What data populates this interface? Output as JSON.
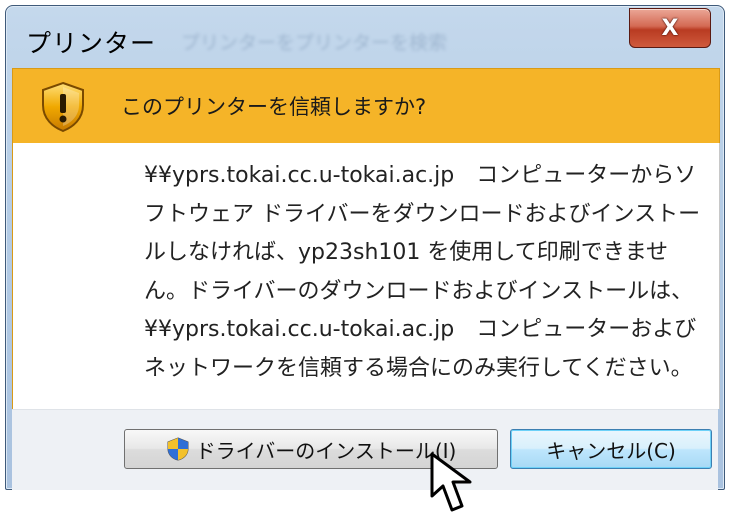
{
  "window": {
    "title": "プリンター",
    "title_ghost": "プリンターをプリンターを検索"
  },
  "title_buttons": {
    "close_label": "X",
    "close_icon": "close-icon"
  },
  "banner": {
    "icon": "shield-warning-icon",
    "message": "このプリンターを信頼しますか?",
    "color": "#f5b428"
  },
  "body": {
    "lines": [
      "¥¥yprs.tokai.cc.u-tokai.ac.jp　コンピューターからソ",
      "フトウェア ドライバーをダウンロードおよびインストー",
      "ルしなければ、yp23sh101 を使用して印刷できませ",
      "ん。ドライバーのダウンロードおよびインストールは、",
      "¥¥yprs.tokai.cc.u-tokai.ac.jp　コンピューターおよび",
      "ネットワークを信頼する場合にのみ実行してください。"
    ]
  },
  "buttons": {
    "install": {
      "label": "ドライバーのインストール(I)",
      "icon": "uac-shield-icon"
    },
    "cancel": {
      "label": "キャンセル(C)"
    }
  },
  "cursor": {
    "icon": "mouse-pointer-icon"
  }
}
